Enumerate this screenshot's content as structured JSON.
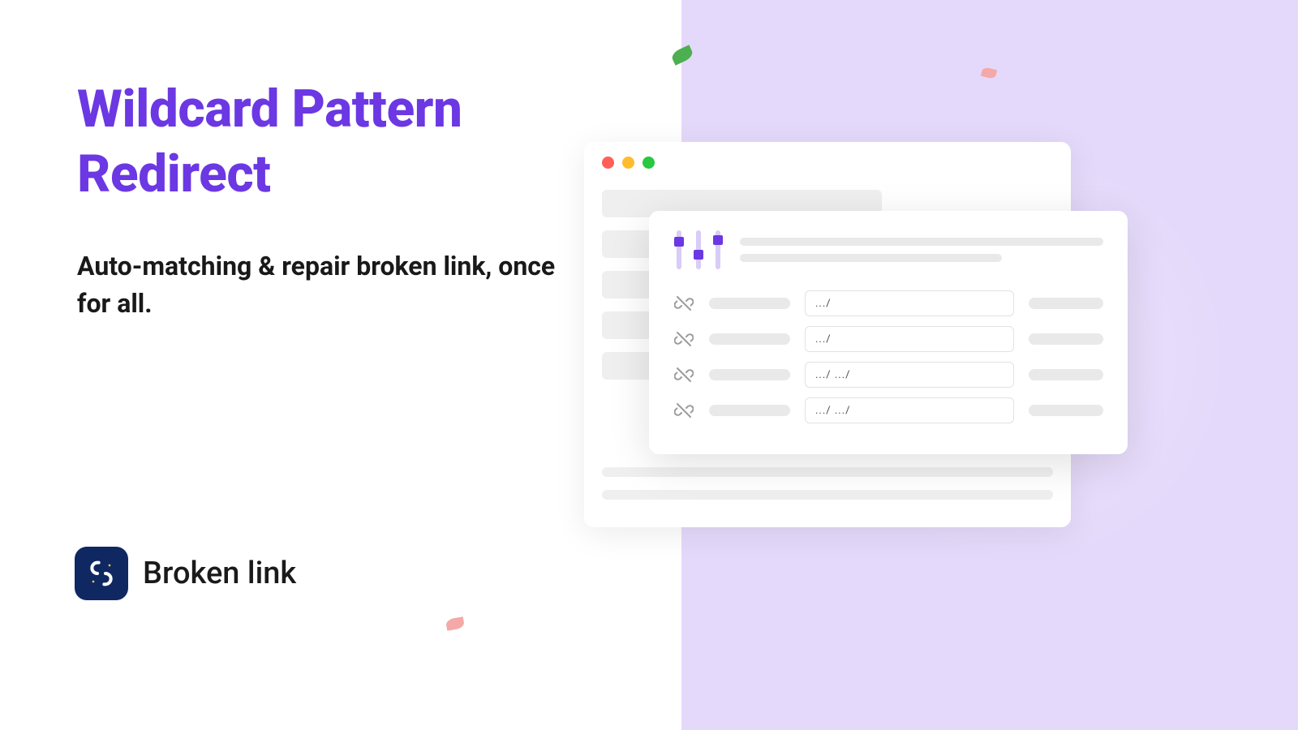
{
  "title": "Wildcard Pattern Redirect",
  "subtitle": "Auto-matching & repair broken link, once for all.",
  "brand": {
    "name": "Broken link"
  },
  "window": {
    "patterns": [
      ".../",
      ".../",
      ".../ .../",
      ".../ .../"
    ]
  },
  "colors": {
    "accent": "#6b38e3",
    "lavender": "#e5d9fb"
  }
}
